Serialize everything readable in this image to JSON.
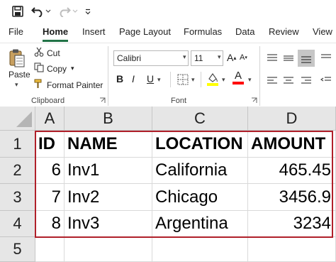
{
  "qat": {
    "icons": [
      "save-icon",
      "undo-icon",
      "redo-icon",
      "customize-icon"
    ],
    "separator": "|"
  },
  "tabs": [
    "File",
    "Home",
    "Insert",
    "Page Layout",
    "Formulas",
    "Data",
    "Review",
    "View"
  ],
  "active_tab": "Home",
  "clipboard": {
    "paste_label": "Paste",
    "cut_label": "Cut",
    "copy_label": "Copy",
    "format_painter_label": "Format Painter",
    "group_label": "Clipboard"
  },
  "font": {
    "family_value": "Calibri",
    "size_value": "11",
    "group_label": "Font",
    "grow_glyph": "A",
    "bold_glyph": "B",
    "italic_glyph": "I",
    "underline_glyph": "U",
    "font_color_glyph": "A"
  },
  "colors": {
    "accent": "#217346",
    "selection_border": "#b0202a",
    "header_bg": "#e6e6e6",
    "highlight": "#ffff00",
    "font_color": "#ff0000"
  },
  "sheet": {
    "columns": [
      "A",
      "B",
      "C",
      "D"
    ],
    "rows": [
      "1",
      "2",
      "3",
      "4",
      "5"
    ],
    "cells": [
      [
        "ID",
        "NAME",
        "LOCATION",
        "AMOUNT"
      ],
      [
        "6",
        "Inv1",
        "California",
        "465.45"
      ],
      [
        "7",
        "Inv2",
        "Chicago",
        "3456.9"
      ],
      [
        "8",
        "Inv3",
        "Argentina",
        "3234"
      ],
      [
        "",
        "",
        "",
        ""
      ]
    ]
  }
}
